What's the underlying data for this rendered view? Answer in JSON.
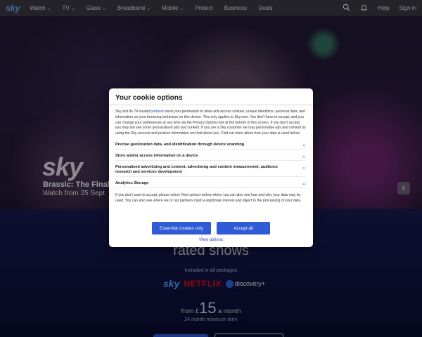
{
  "nav": {
    "brand": "sky",
    "items": [
      {
        "label": "Watch",
        "dropdown": true
      },
      {
        "label": "TV",
        "dropdown": true
      },
      {
        "label": "Glass",
        "dropdown": true
      },
      {
        "label": "Broadband",
        "dropdown": true
      },
      {
        "label": "Mobile",
        "dropdown": true
      },
      {
        "label": "Protect",
        "dropdown": false
      },
      {
        "label": "Business",
        "dropdown": false
      },
      {
        "label": "Deals",
        "dropdown": false
      }
    ],
    "help": "Help",
    "sign_in": "Sign in",
    "icons": {
      "search": "search-icon",
      "notifications": "bell-icon",
      "chevron": "chevron-down-icon"
    }
  },
  "hero": {
    "logo": "sky",
    "title": "Brassic: The Final F",
    "subtitle": "Watch from 25 Sept",
    "pause_glyph": "II"
  },
  "promo": {
    "heading": "rated shows",
    "included": "Included in all packages",
    "logos": {
      "sky": "sky",
      "netflix": "NETFLIX",
      "discovery": "discovery+"
    },
    "price_prefix": "from £",
    "price_value": "15",
    "price_suffix": "a month",
    "term": "24 month minimum term"
  },
  "modal": {
    "title": "Your cookie options",
    "intro_before_link": "Sky and its 74 trusted ",
    "intro_link": "partners",
    "intro_after_link": " need your permission to store and access cookies, unique identifiers, personal data, and information on your browsing behaviour on this device. This only applies to Sky.com. You don't have to accept, and you can change your preferences at any time via the Privacy Options link at the bottom of this screen. If you don't accept, you may not see some personalised ads and content. If you are a Sky customer we may personalise ads and content by using the Sky account and product information we hold about you. Find out more about how your data is used below.",
    "sections": [
      "Precise geolocation data, and identification through device scanning",
      "Store and/or access information on a device",
      "Personalised advertising and content, advertising and content measurement, audience research and services development",
      "Analytics Storage"
    ],
    "note": "If you don't want to accept, please select View options below where you can also see how and why your data may be used. You can also see where we or our partners claim a legitimate interest and object to the processing of your data.",
    "buttons": {
      "essential": "Essential cookies only",
      "accept": "Accept all"
    },
    "view_options": "View options"
  },
  "colors": {
    "nav_bg": "#3a3a42",
    "brand_blue": "#5aa6ff",
    "button_blue": "#2f5bd6",
    "link_blue": "#1f4bd1",
    "promo_bg": "#161a4e",
    "netflix_red": "#e50914"
  }
}
